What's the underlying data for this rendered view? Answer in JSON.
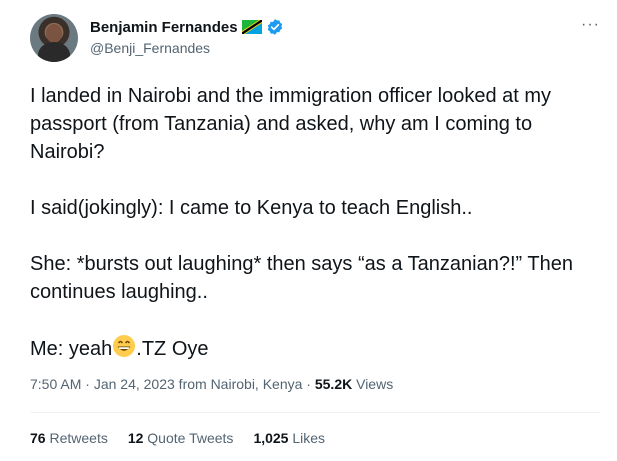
{
  "author": {
    "name": "Benjamin Fernandes",
    "handle": "@Benji_Fernandes"
  },
  "more_label": "···",
  "tweet": {
    "p1": "I landed in Nairobi and the immigration officer looked at my passport (from Tanzania) and asked, why am I coming to Nairobi?",
    "p2": "I said(jokingly): I came to Kenya to teach English..",
    "p3": "She: *bursts out laughing* then says “as a Tanzanian?!” Then continues laughing..",
    "p4_before": "Me: yeah",
    "p4_after": ".TZ Oye"
  },
  "meta": {
    "time": "7:50 AM",
    "sep1": " · ",
    "date": "Jan 24, 2023",
    "source": " from Nairobi, Kenya",
    "sep2": " · ",
    "views_count": "55.2K",
    "views_label": " Views"
  },
  "stats": {
    "retweets_count": "76",
    "retweets_label": "Retweets",
    "quotes_count": "12",
    "quotes_label": "Quote Tweets",
    "likes_count": "1,025",
    "likes_label": "Likes"
  },
  "icons": {
    "flag": "tanzania-flag-icon",
    "verified": "verified-badge-icon",
    "emoji": "grinning-face-emoji"
  },
  "colors": {
    "verified": "#1d9bf0",
    "secondary_text": "#536471",
    "divider": "#eff3f4"
  }
}
